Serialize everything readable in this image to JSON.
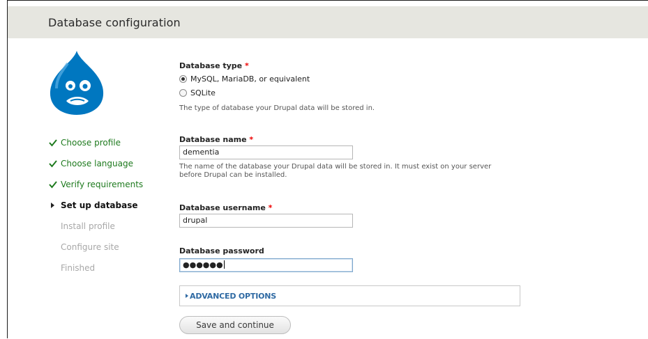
{
  "header": {
    "title": "Database configuration"
  },
  "steps": [
    {
      "label": "Choose profile",
      "state": "done"
    },
    {
      "label": "Choose language",
      "state": "done"
    },
    {
      "label": "Verify requirements",
      "state": "done"
    },
    {
      "label": "Set up database",
      "state": "active"
    },
    {
      "label": "Install profile",
      "state": "pending"
    },
    {
      "label": "Configure site",
      "state": "pending"
    },
    {
      "label": "Finished",
      "state": "pending"
    }
  ],
  "form": {
    "db_type": {
      "label": "Database type",
      "required_mark": "*",
      "options": [
        {
          "label": "MySQL, MariaDB, or equivalent",
          "selected": true
        },
        {
          "label": "SQLite",
          "selected": false
        }
      ],
      "description": "The type of database your Drupal data will be stored in."
    },
    "db_name": {
      "label": "Database name",
      "required_mark": "*",
      "value": "dementia",
      "description_line1": "The name of the database your Drupal data will be stored in. It must exist on your server",
      "description_line2": "before Drupal can be installed."
    },
    "db_user": {
      "label": "Database username",
      "required_mark": "*",
      "value": "drupal"
    },
    "db_pass": {
      "label": "Database password",
      "masked_value": "●●●●●●"
    },
    "advanced": {
      "label": "ADVANCED OPTIONS"
    },
    "submit": {
      "label": "Save and continue"
    }
  },
  "colors": {
    "done": "#1e7a1e",
    "pending": "#a8a8a8",
    "link": "#2f6aa3",
    "required": "#ee0000",
    "logo": "#0077c0"
  },
  "icons": {
    "done": "check-icon",
    "active": "triangle-right-icon",
    "logo": "drupal-drop-logo"
  }
}
